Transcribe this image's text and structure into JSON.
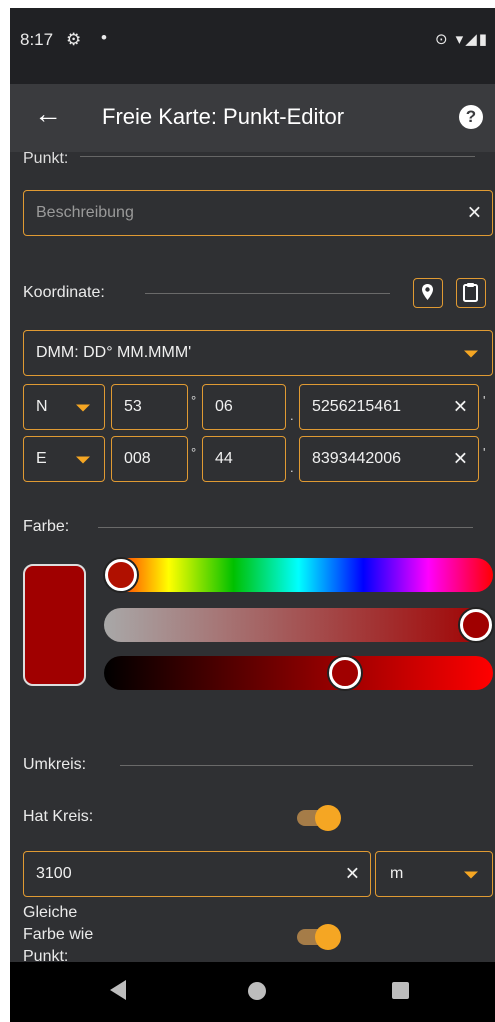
{
  "status": {
    "time": "8:17",
    "gear_icon": "⚙",
    "dot": "•",
    "right_icons": "⊙ ▾◢▮"
  },
  "appbar": {
    "back_icon": "←",
    "title": "Freie Karte: Punkt-Editor",
    "help_icon": "?"
  },
  "point": {
    "label": "Punkt:",
    "description_placeholder": "Beschreibung",
    "clear_icon": "✕"
  },
  "coordinate": {
    "label": "Koordinate:",
    "format": "DMM: DD° MM.MMM'",
    "lat": {
      "hemisphere": "N",
      "deg": "53",
      "min": "06",
      "frac": "5256215461"
    },
    "lon": {
      "hemisphere": "E",
      "deg": "008",
      "min": "44",
      "frac": "8393442006"
    },
    "deg_symbol": "°",
    "dot_symbol": ".",
    "prime_symbol": "'"
  },
  "color": {
    "label": "Farbe:",
    "swatch_color": "#a00000",
    "hue": 0.0,
    "saturation": 1.0,
    "value": 0.63
  },
  "circle": {
    "label": "Umkreis:",
    "has_circle_label": "Hat Kreis:",
    "has_circle": true,
    "radius": "3100",
    "unit": "m",
    "same_color_label_1": "Gleiche",
    "same_color_label_2": "Farbe wie",
    "same_color_label_3": "Punkt:",
    "same_color": true
  },
  "accent_color": "#f5a623"
}
